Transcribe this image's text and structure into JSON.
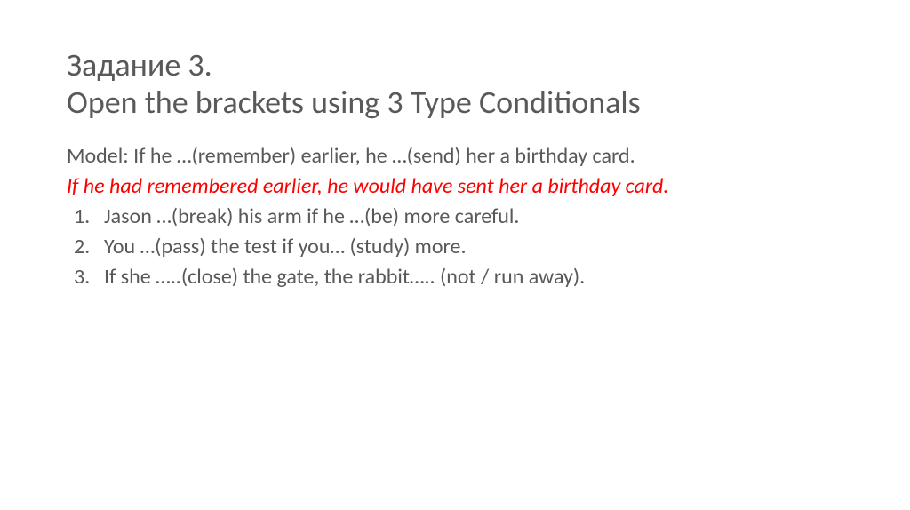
{
  "task_label": "Задание 3.",
  "task_instruction": "Open the brackets using 3 Type Conditionals",
  "model_prefix": "Model: ",
  "model_text": "If he …(remember) earlier, he …(send) her a birthday card.",
  "model_answer": "If he had remembered earlier, he would have sent her a birthday card.",
  "items": [
    "Jason …(break) his arm if he …(be) more careful.",
    "You …(pass) the test if you… (study) more.",
    "If she …..(close) the gate, the rabbit….. (not / run away)."
  ]
}
